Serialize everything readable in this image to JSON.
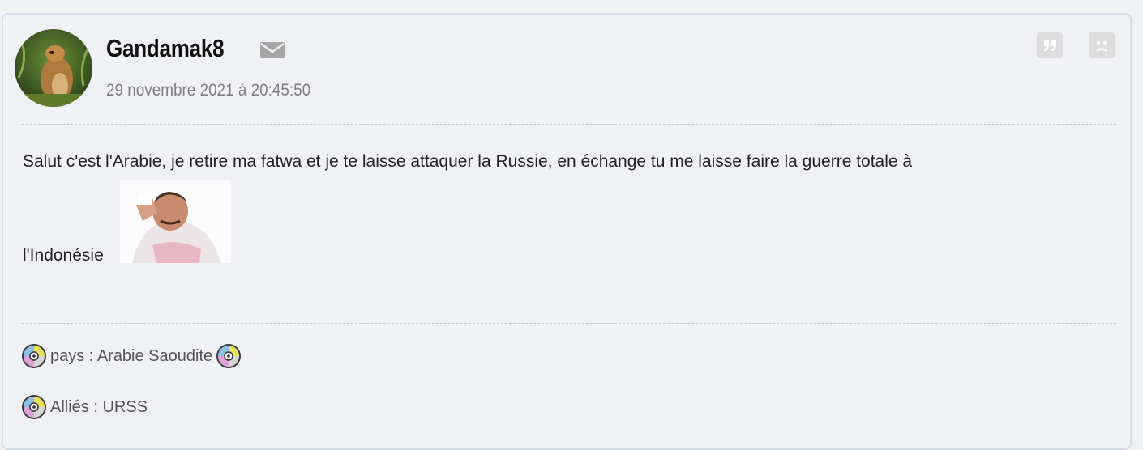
{
  "post": {
    "author": "Gandamak8",
    "timestamp": "29 novembre 2021 à 20:45:50",
    "message_line1": "Salut c'est l'Arabie, je retire ma fatwa et je te laisse attaquer la Russie, en échange tu me laisse faire la guerre totale à",
    "message_line2": "l'Indonésie"
  },
  "signature": {
    "line1": "pays : Arabie Saoudite",
    "line2": "Alliés : URSS"
  },
  "icons": {
    "mail": "envelope-icon",
    "quote": "quote-icon",
    "report": "sad-face-icon",
    "cd": "cd-disc-icon"
  },
  "colors": {
    "card_background": "#f0f1f5",
    "card_border": "#d6dce6",
    "button_background": "#dcdcdc",
    "meta_text": "#808080"
  }
}
